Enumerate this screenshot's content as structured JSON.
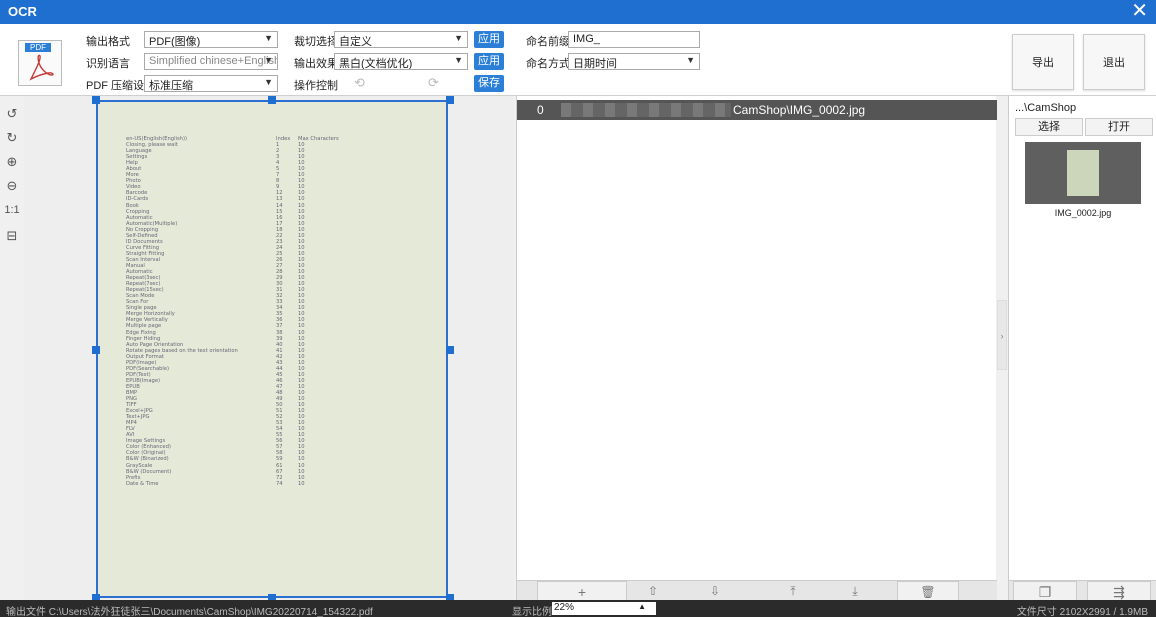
{
  "titlebar": {
    "title": "OCR",
    "close": "✕"
  },
  "toolbar": {
    "pdf_tag": "PDF",
    "output_format_label": "输出格式",
    "output_format_value": "PDF(图像)",
    "ocr_lang_label": "识别语言",
    "ocr_lang_value": "Simplified chinese+English",
    "pdf_compress_label": "PDF 压缩设置",
    "pdf_compress_value": "标准压缩",
    "crop_label": "裁切选择",
    "crop_value": "自定义",
    "effect_label": "输出效果",
    "effect_value": "黑白(文档优化)",
    "control_label": "操作控制",
    "apply1": "应用",
    "apply2": "应用",
    "save": "保存",
    "prefix_label": "命名前缀",
    "prefix_value": "IMG_",
    "naming_label": "命名方式",
    "naming_value": "日期时间",
    "export": "导出",
    "exit": "退出"
  },
  "lefttools": {
    "rotate_left": "↺",
    "rotate_right": "↻",
    "zoom_in": "⊕",
    "zoom_out": "⊖",
    "actual": "1:1",
    "fit": "⊟"
  },
  "document": {
    "header": {
      "name": "en-US(English(English))",
      "idx": "Index",
      "max": "Max Characters"
    },
    "rows": [
      [
        "Closing, please wait",
        "1",
        "10"
      ],
      [
        "Language",
        "2",
        "10"
      ],
      [
        "Settings",
        "3",
        "10"
      ],
      [
        "Help",
        "4",
        "10"
      ],
      [
        "About",
        "5",
        "10"
      ],
      [
        "More",
        "7",
        "10"
      ],
      [
        "Photo",
        "8",
        "10"
      ],
      [
        "Video",
        "9",
        "10"
      ],
      [
        "Barcode",
        "12",
        "10"
      ],
      [
        "ID-Cards",
        "13",
        "10"
      ],
      [
        "Book",
        "14",
        "10"
      ],
      [
        "Cropping",
        "15",
        "10"
      ],
      [
        "Automatic",
        "16",
        "10"
      ],
      [
        "Automatic(Multiple)",
        "17",
        "10"
      ],
      [
        "No Cropping",
        "18",
        "10"
      ],
      [
        "Self-Defined",
        "22",
        "10"
      ],
      [
        "ID Documents",
        "23",
        "10"
      ],
      [
        "Curve Fitting",
        "24",
        "10"
      ],
      [
        "Straight Fitting",
        "25",
        "10"
      ],
      [
        "Scan Interval",
        "26",
        "10"
      ],
      [
        "Manual",
        "27",
        "10"
      ],
      [
        "Automatic",
        "28",
        "10"
      ],
      [
        "Repeat(3sec)",
        "29",
        "10"
      ],
      [
        "Repeat(7sec)",
        "30",
        "10"
      ],
      [
        "Repeat(15sec)",
        "31",
        "10"
      ],
      [
        "Scan Mode",
        "32",
        "10"
      ],
      [
        "Scan For",
        "33",
        "10"
      ],
      [
        "Single page",
        "34",
        "10"
      ],
      [
        "Merge Horizontally",
        "35",
        "10"
      ],
      [
        "Merge Vertically",
        "36",
        "10"
      ],
      [
        "Multiple page",
        "37",
        "10"
      ],
      [
        "Edge Fixing",
        "38",
        "10"
      ],
      [
        "Finger Hiding",
        "39",
        "10"
      ],
      [
        "Auto Page Orientation",
        "40",
        "10"
      ],
      [
        "Rotate pages based on the text orientation",
        "41",
        "10"
      ],
      [
        "Output Format",
        "42",
        "10"
      ],
      [
        "PDF(Image)",
        "43",
        "10"
      ],
      [
        "PDF(Searchable)",
        "44",
        "10"
      ],
      [
        "PDF(Text)",
        "45",
        "10"
      ],
      [
        "EPUB(Image)",
        "46",
        "10"
      ],
      [
        "EPUB",
        "47",
        "10"
      ],
      [
        "BMP",
        "48",
        "10"
      ],
      [
        "PNG",
        "49",
        "10"
      ],
      [
        "TIFF",
        "50",
        "10"
      ],
      [
        "Excel+JPG",
        "51",
        "10"
      ],
      [
        "Text+JPG",
        "52",
        "10"
      ],
      [
        "MP4",
        "53",
        "10"
      ],
      [
        "FLV",
        "54",
        "10"
      ],
      [
        "AVI",
        "55",
        "10"
      ],
      [
        "Image Settings",
        "56",
        "10"
      ],
      [
        "Color (Enhanced)",
        "57",
        "10"
      ],
      [
        "Color (Original)",
        "58",
        "10"
      ],
      [
        "B&W (Binarized)",
        "59",
        "10"
      ],
      [
        "GrayScale",
        "61",
        "10"
      ],
      [
        "B&W (Document)",
        "67",
        "10"
      ],
      [
        "Prefix",
        "72",
        "10"
      ],
      [
        "Date & Time",
        "74",
        "10"
      ]
    ]
  },
  "list": {
    "index": "0",
    "path": "CamShop\\IMG_0002.jpg",
    "add": "+",
    "up": "⇧",
    "down": "⇩",
    "top": "⤒",
    "bottom": "⤓",
    "delete": "🗑"
  },
  "splitter": {
    "arrow": "›"
  },
  "right": {
    "folder": "...\\CamShop",
    "choose": "选择",
    "open": "打开",
    "thumb_label": "IMG_0002.jpg",
    "copy_icon": "❐",
    "export_icon": "⇶"
  },
  "status": {
    "output_file": "输出文件  C:\\Users\\法外狂徒张三\\Documents\\CamShop\\IMG20220714_154322.pdf",
    "zoom_label": "显示比例",
    "zoom_value": "22%",
    "file_size": "文件尺寸  2102X2991 / 1.9MB"
  },
  "colors": {
    "accent": "#1e6fd0",
    "button": "#2b7fd6",
    "status_bg": "#2b2b2b",
    "header_row": "#555555"
  }
}
